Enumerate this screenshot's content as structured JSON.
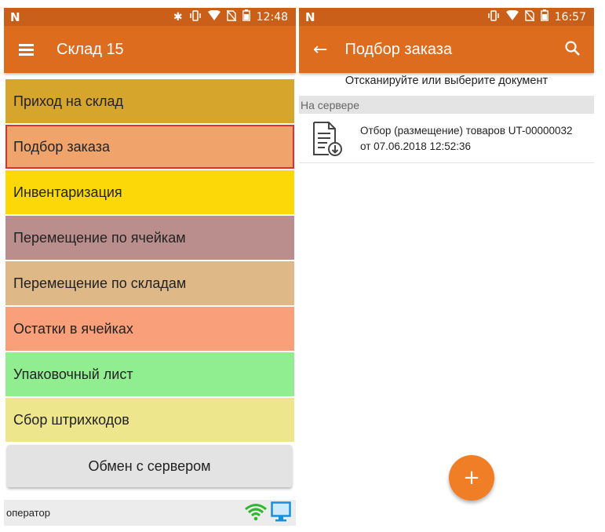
{
  "left": {
    "status": {
      "time": "12:48"
    },
    "appbar": {
      "title": "Склад 15"
    },
    "menu": [
      {
        "label": "Приход на склад",
        "color": "#d6a52c"
      },
      {
        "label": "Подбор заказа",
        "color": "#f0a46c",
        "selected": true
      },
      {
        "label": "Инвентаризация",
        "color": "#fdd808"
      },
      {
        "label": "Перемещение по ячейкам",
        "color": "#bb8e8e"
      },
      {
        "label": "Перемещение по складам",
        "color": "#deb887"
      },
      {
        "label": "Остатки в ячейках",
        "color": "#f9a07a"
      },
      {
        "label": "Упаковочный лист",
        "color": "#90ee90"
      },
      {
        "label": "Сбор штрихкодов",
        "color": "#ede68c"
      }
    ],
    "exchange_button": "Обмен с сервером",
    "footer": {
      "user": "оператор"
    }
  },
  "right": {
    "status": {
      "time": "16:57"
    },
    "appbar": {
      "title": "Подбор заказа"
    },
    "hint": "Отсканируйте или выберите документ",
    "section": "На сервере",
    "document": {
      "line1": "Отбор (размещение) товаров UT-00000032",
      "line2": "от 07.06.2018 12:52:36"
    },
    "fab": "+"
  },
  "colors": {
    "statusbar": "#c95f18",
    "appbar": "#dd6c1e",
    "fab": "#f07e26",
    "selected_outline": "#e0302a",
    "wifi": "#2db82d",
    "monitor": "#1a8fd8"
  },
  "icons": [
    "menu-icon",
    "back-arrow-icon",
    "search-icon",
    "bluetooth-icon",
    "vibrate-icon",
    "wifi-icon",
    "no-sim-icon",
    "battery-icon",
    "document-download-icon",
    "monitor-icon"
  ]
}
